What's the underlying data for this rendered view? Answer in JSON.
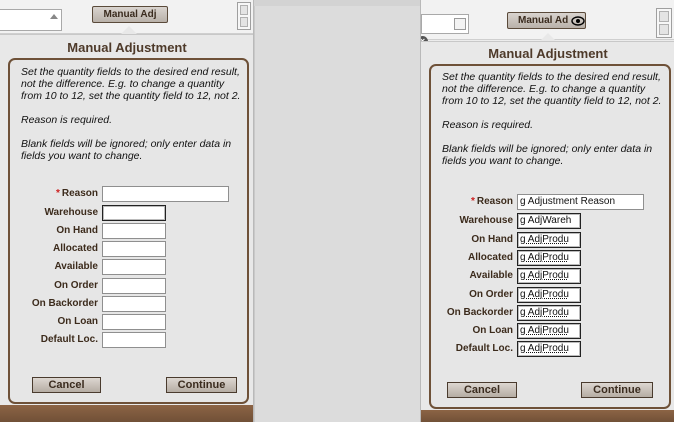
{
  "left": {
    "top_button": "Manual Adj",
    "title": "Manual Adjustment",
    "instructions": [
      "Set the quantity fields to the desired end result, not the difference.  E.g. to change a quantity from 10 to 12, set the quantity field to 12, not 2.",
      "Reason is required.",
      "Blank fields will be ignored; only enter data in fields you want to change."
    ],
    "fields": [
      {
        "label": "Reason",
        "required_mark": "*",
        "value": ""
      },
      {
        "label": "Warehouse",
        "value": ""
      },
      {
        "label": "On  Hand",
        "value": ""
      },
      {
        "label": "Allocated",
        "value": ""
      },
      {
        "label": "Available",
        "value": ""
      },
      {
        "label": "On Order",
        "value": ""
      },
      {
        "label": "On Backorder",
        "value": ""
      },
      {
        "label": "On Loan",
        "value": ""
      },
      {
        "label": "Default Loc.",
        "value": ""
      }
    ],
    "cancel": "Cancel",
    "continue": "Continue"
  },
  "right": {
    "top_button": "Manual Ad",
    "title": "Manual Adjustment",
    "instructions": [
      "Set the quantity fields to the desired end result, not the difference.  E.g. to change a quantity from 10 to 12, set the quantity field to 12, not 2.",
      "Reason is required.",
      "Blank fields will be ignored; only enter data in fields you want to change."
    ],
    "fields": [
      {
        "label": "Reason",
        "required_mark": "*",
        "value": "g Adjustment Reason"
      },
      {
        "label": "Warehouse",
        "value": "g AdjWareh"
      },
      {
        "label": "On  Hand",
        "value": "g AdjProdu"
      },
      {
        "label": "Allocated",
        "value": "g AdjProdu"
      },
      {
        "label": "Available",
        "value": "g AdjProdu"
      },
      {
        "label": "On Order",
        "value": "g AdjProdu"
      },
      {
        "label": "On Backorder",
        "value": "g AdjProdu"
      },
      {
        "label": "On Loan",
        "value": "g AdjProdu"
      },
      {
        "label": "Default Loc.",
        "value": "g AdjProdu"
      }
    ],
    "cancel": "Cancel",
    "continue": "Continue"
  },
  "icons": {
    "close": "close-icon",
    "eye": "eye-icon",
    "scroll_up": "scroll-up-arrow-icon"
  }
}
